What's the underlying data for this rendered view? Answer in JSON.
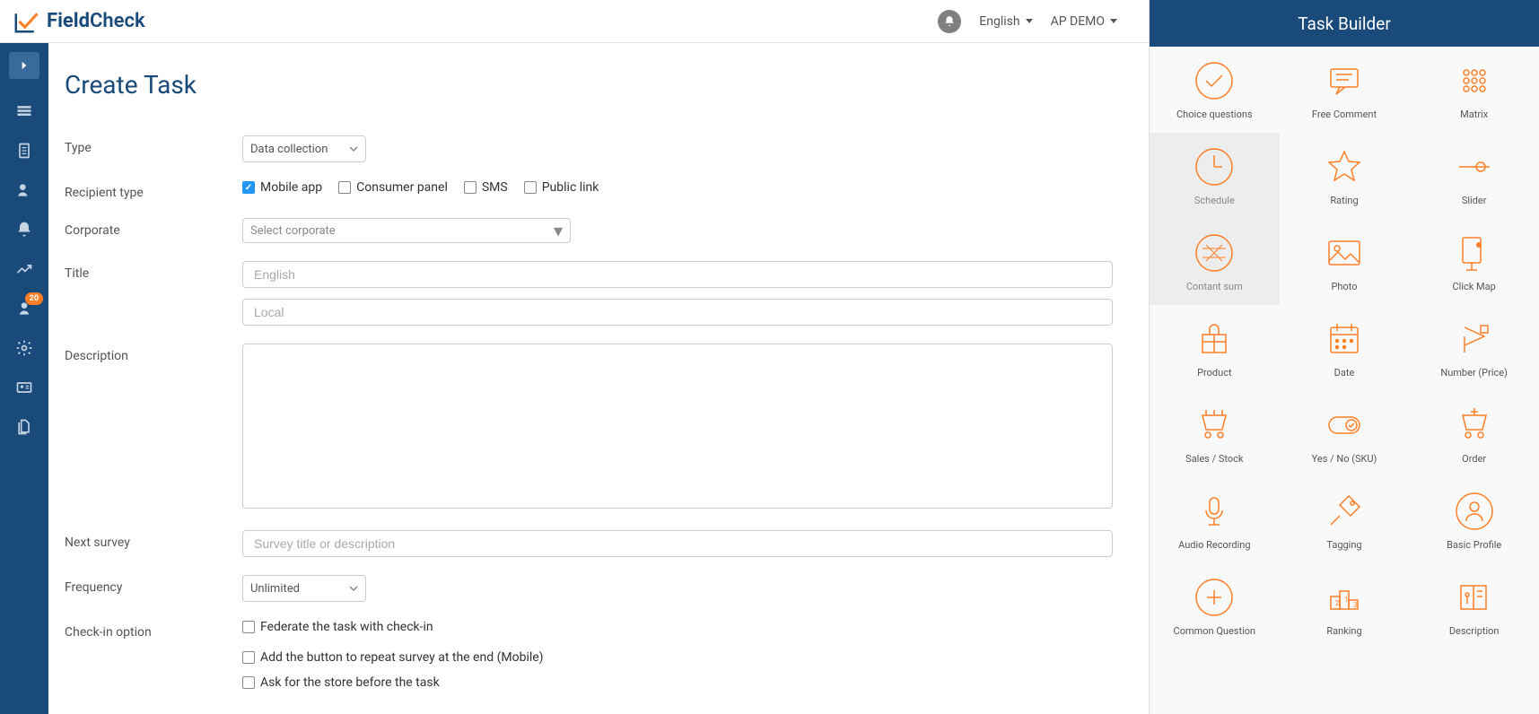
{
  "header": {
    "brand_part1": "Field",
    "brand_part2": "Check",
    "language": "English",
    "account": "AP DEMO"
  },
  "sidebar": {
    "badge_count": "20"
  },
  "page": {
    "title": "Create Task",
    "labels": {
      "type": "Type",
      "recipient": "Recipient type",
      "corporate": "Corporate",
      "title": "Title",
      "description": "Description",
      "next_survey": "Next survey",
      "frequency": "Frequency",
      "checkin": "Check-in option"
    },
    "type_value": "Data collection",
    "recipient_options": {
      "mobile": "Mobile app",
      "consumer": "Consumer panel",
      "sms": "SMS",
      "public": "Public link"
    },
    "corporate_placeholder": "Select corporate",
    "title_placeholder_en": "English",
    "title_placeholder_local": "Local",
    "next_survey_placeholder": "Survey title or description",
    "frequency_value": "Unlimited",
    "checkin_options": {
      "federate": "Federate the task with check-in",
      "repeat": "Add the button to repeat survey at the end (Mobile)",
      "ask_store": "Ask for the store before the task"
    }
  },
  "taskbuilder": {
    "title": "Task Builder",
    "items": [
      {
        "label": "Choice questions",
        "disabled": false
      },
      {
        "label": "Free Comment",
        "disabled": false
      },
      {
        "label": "Matrix",
        "disabled": false
      },
      {
        "label": "Schedule",
        "disabled": true
      },
      {
        "label": "Rating",
        "disabled": false
      },
      {
        "label": "Slider",
        "disabled": false
      },
      {
        "label": "Contant sum",
        "disabled": true
      },
      {
        "label": "Photo",
        "disabled": false
      },
      {
        "label": "Click Map",
        "disabled": false
      },
      {
        "label": "Product",
        "disabled": false
      },
      {
        "label": "Date",
        "disabled": false
      },
      {
        "label": "Number (Price)",
        "disabled": false
      },
      {
        "label": "Sales / Stock",
        "disabled": false
      },
      {
        "label": "Yes / No (SKU)",
        "disabled": false
      },
      {
        "label": "Order",
        "disabled": false
      },
      {
        "label": "Audio Recording",
        "disabled": false
      },
      {
        "label": "Tagging",
        "disabled": false
      },
      {
        "label": "Basic Profile",
        "disabled": false
      },
      {
        "label": "Common Question",
        "disabled": false
      },
      {
        "label": "Ranking",
        "disabled": false
      },
      {
        "label": "Description",
        "disabled": false
      }
    ]
  }
}
